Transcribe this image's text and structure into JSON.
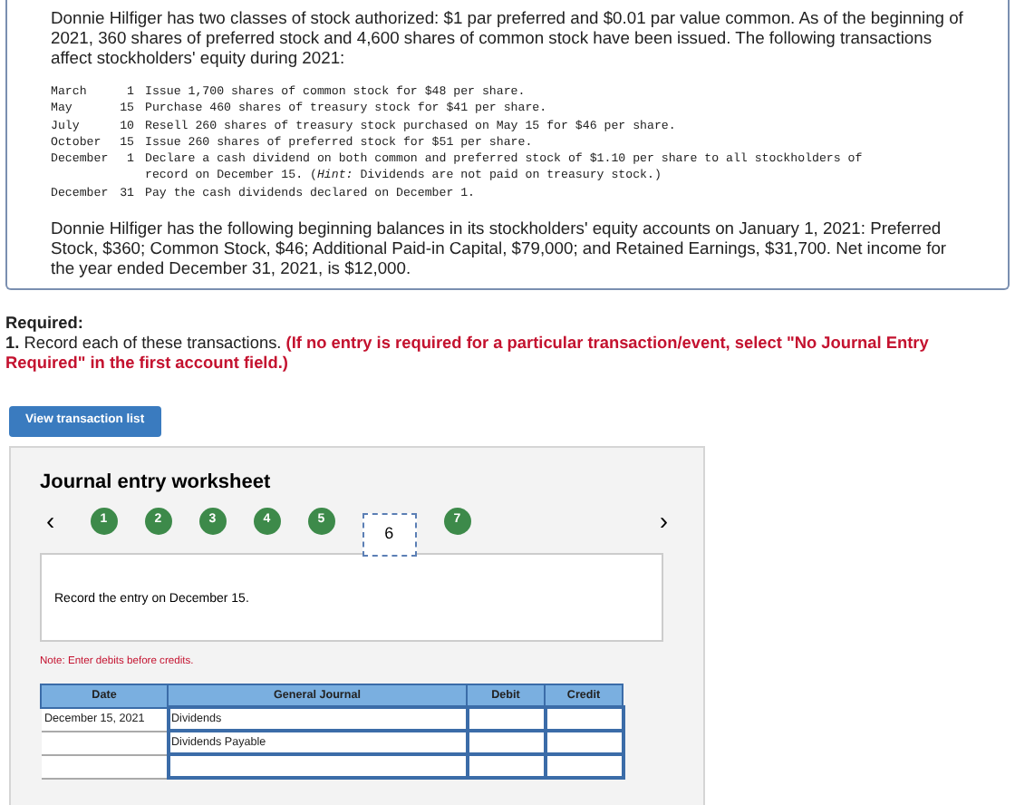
{
  "intro": "Donnie Hilfiger has two classes of stock authorized: $1 par preferred and $0.01 par value common. As of the beginning of 2021, 360 shares of preferred stock and 4,600 shares of common stock have been issued. The following transactions affect stockholders' equity during 2021:",
  "transactions": [
    {
      "month": "March",
      "day": "1",
      "text": "Issue 1,700 shares of common stock for $48 per share."
    },
    {
      "month": "May",
      "day": "15",
      "text": "Purchase 460 shares of treasury stock for $41 per share."
    },
    {
      "month": "July",
      "day": "10",
      "text": "Resell 260 shares of treasury stock purchased on May 15 for $46 per share."
    },
    {
      "month": "October",
      "day": "15",
      "text": "Issue 260 shares of preferred stock for $51 per share."
    },
    {
      "month": "December",
      "day": "1",
      "text": "Declare a cash dividend on both common and preferred stock of $1.10 per share to all stockholders of record on December 15. (*Hint:* Dividends are not paid on treasury stock.)"
    },
    {
      "month": "December",
      "day": "31",
      "text": "Pay the cash dividends declared on December 1."
    }
  ],
  "balances": "Donnie Hilfiger has the following beginning balances in its stockholders' equity accounts on January 1, 2021: Preferred Stock, $360; Common Stock, $46; Additional Paid-in Capital, $79,000; and Retained Earnings, $31,700. Net income for the year ended December 31, 2021, is $12,000.",
  "required": {
    "heading": "Required:",
    "number": "1.",
    "text": "Record each of these transactions.",
    "note": "(If no entry is required for a particular transaction/event, select \"No Journal Entry Required\" in the first account field.)"
  },
  "view_button": "View transaction list",
  "worksheet": {
    "title": "Journal entry worksheet",
    "prev": "‹",
    "next": "›",
    "steps": [
      {
        "label": "1",
        "selected": false
      },
      {
        "label": "2",
        "selected": false
      },
      {
        "label": "3",
        "selected": false
      },
      {
        "label": "4",
        "selected": false
      },
      {
        "label": "5",
        "selected": false
      },
      {
        "label": "6",
        "selected": true
      },
      {
        "label": "7",
        "selected": false
      }
    ],
    "instruction": "Record the entry on December 15.",
    "note": "Note: Enter debits before credits.",
    "columns": [
      "Date",
      "General Journal",
      "Debit",
      "Credit"
    ],
    "rows": [
      {
        "date": "December 15, 2021",
        "account": "Dividends"
      },
      {
        "account": "Dividends Payable"
      },
      {}
    ]
  }
}
